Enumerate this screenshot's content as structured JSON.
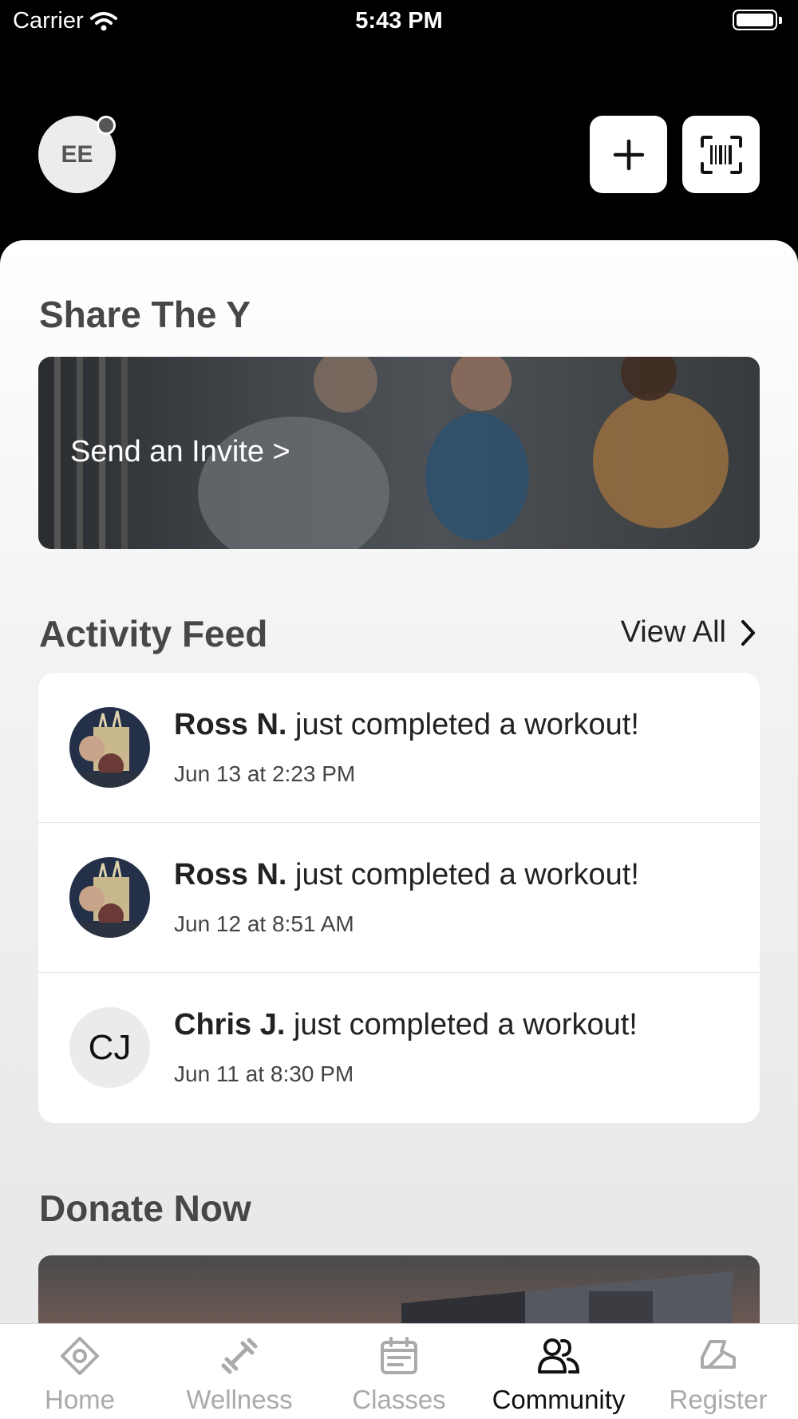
{
  "status_bar": {
    "carrier": "Carrier",
    "time": "5:43 PM"
  },
  "header": {
    "avatar_initials": "EE"
  },
  "share": {
    "title": "Share The Y",
    "invite_label": "Send an Invite >"
  },
  "activity": {
    "title": "Activity Feed",
    "view_all": "View All",
    "items": [
      {
        "name": "Ross N.",
        "text": " just completed a workout!",
        "time": "Jun 13 at 2:23 PM"
      },
      {
        "name": "Ross N.",
        "text": " just completed a workout!",
        "time": "Jun 12 at 8:51 AM"
      },
      {
        "name": "Chris J.",
        "text": " just completed a workout!",
        "time": "Jun 11 at 8:30 PM",
        "initials": "CJ"
      }
    ]
  },
  "donate": {
    "title": "Donate Now"
  },
  "tabs": [
    {
      "label": "Home",
      "icon": "home-icon"
    },
    {
      "label": "Wellness",
      "icon": "dumbbell-icon"
    },
    {
      "label": "Classes",
      "icon": "calendar-icon"
    },
    {
      "label": "Community",
      "icon": "people-icon",
      "active": true
    },
    {
      "label": "Register",
      "icon": "register-icon"
    }
  ],
  "colors": {
    "header_bg": "#000000",
    "active_tab": "#111111",
    "inactive_tab": "#aaaaaa"
  }
}
